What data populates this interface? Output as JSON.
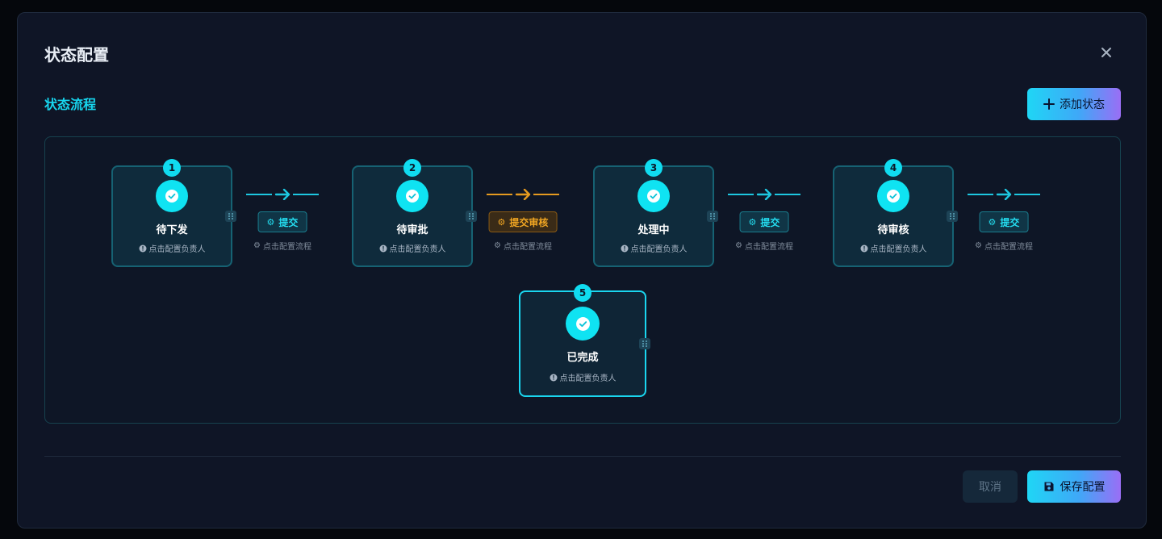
{
  "modal": {
    "title": "状态配置",
    "section_title": "状态流程",
    "add_button_label": "添加状态",
    "cancel_label": "取消",
    "save_label": "保存配置"
  },
  "colors": {
    "accent": "#17d6ef",
    "warning": "#f1a622",
    "gradient_start": "#1fd6f5",
    "gradient_end": "#9a6ef5"
  },
  "nodes": [
    {
      "index": "1",
      "name": "待下发",
      "owner_hint": "点击配置负责人"
    },
    {
      "index": "2",
      "name": "待审批",
      "owner_hint": "点击配置负责人"
    },
    {
      "index": "3",
      "name": "处理中",
      "owner_hint": "点击配置负责人"
    },
    {
      "index": "4",
      "name": "待审核",
      "owner_hint": "点击配置负责人"
    },
    {
      "index": "5",
      "name": "已完成",
      "owner_hint": "点击配置负责人"
    }
  ],
  "transitions": [
    {
      "label": "提交",
      "config_hint": "点击配置流程",
      "style": "normal"
    },
    {
      "label": "提交审核",
      "config_hint": "点击配置流程",
      "style": "warning"
    },
    {
      "label": "提交",
      "config_hint": "点击配置流程",
      "style": "normal"
    },
    {
      "label": "提交",
      "config_hint": "点击配置流程",
      "style": "normal"
    }
  ],
  "icons": {
    "close": "close-icon",
    "add": "plus-icon",
    "check": "check-icon",
    "info": "info-icon",
    "gear": "gear-icon",
    "drag": "drag-handle-icon",
    "save": "save-icon"
  }
}
